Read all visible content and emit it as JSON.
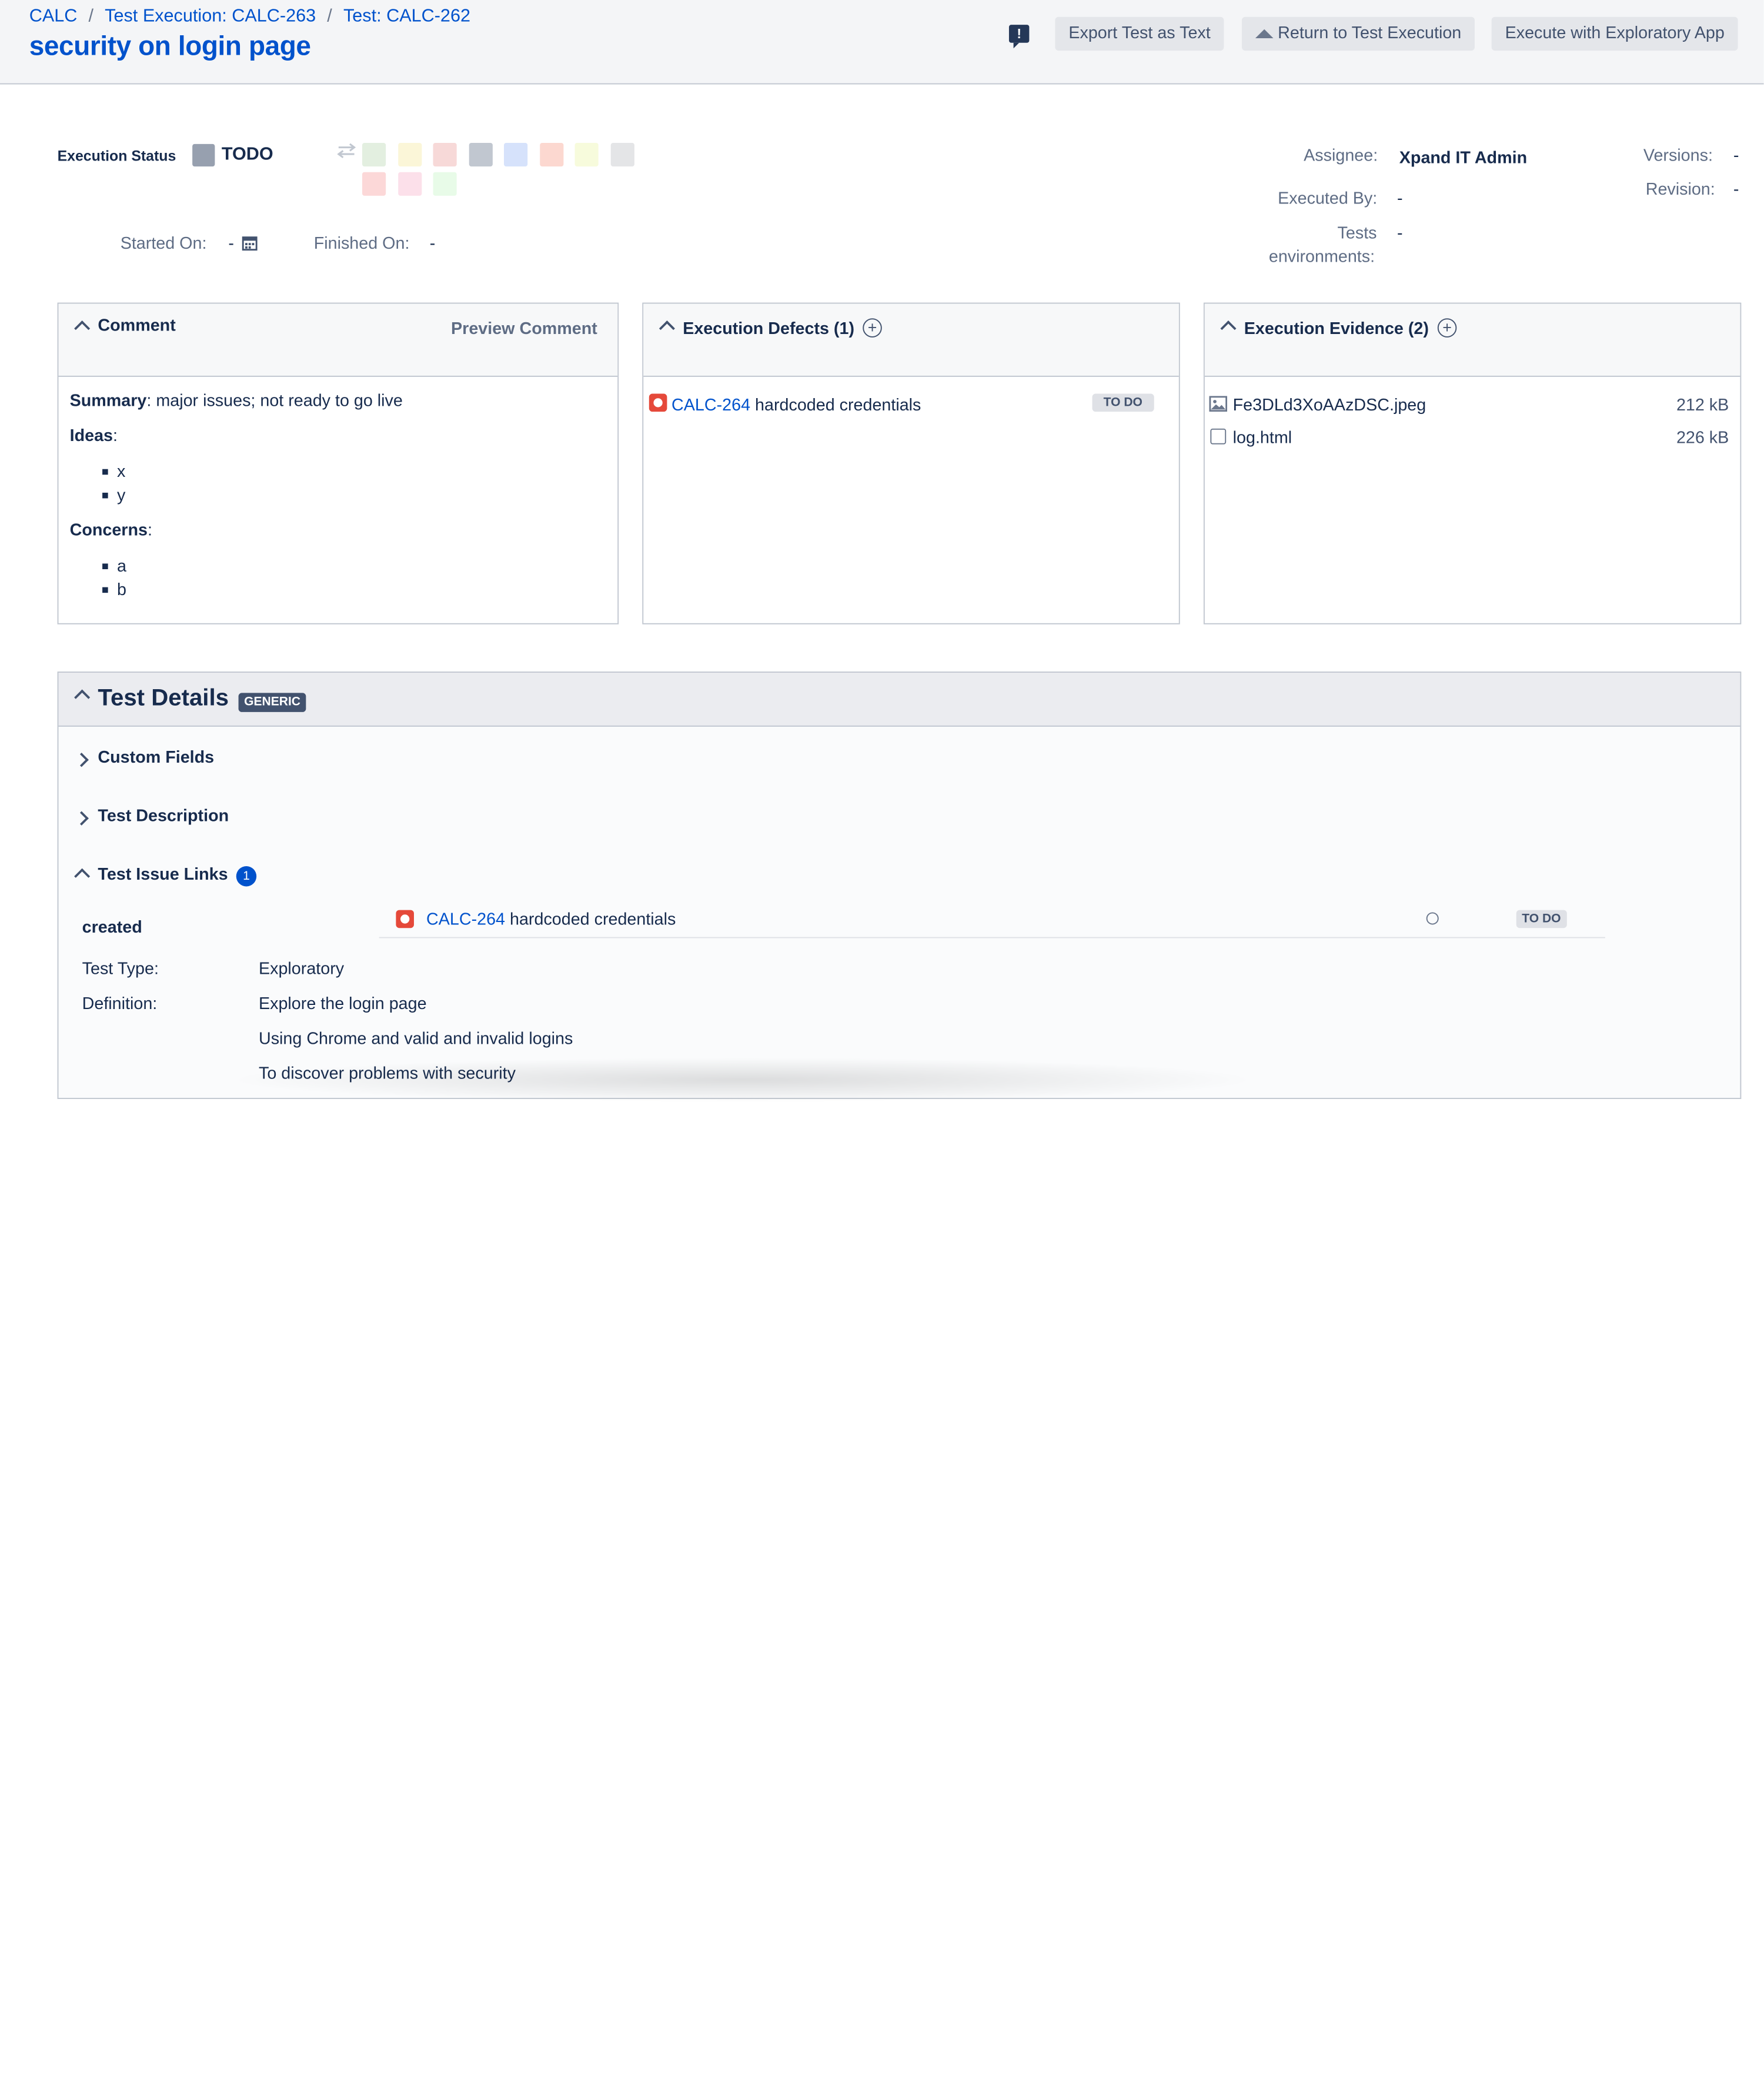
{
  "breadcrumbs": [
    "CALC",
    "Test Execution: CALC-263",
    "Test: CALC-262"
  ],
  "breadcrumb_sep": "/",
  "title": "security on login page",
  "feedback_glyph": "!",
  "toolbar": {
    "export_label": "Export Test as Text",
    "return_label": "Return to Test Execution",
    "exploratory_label": "Execute with Exploratory App"
  },
  "status": {
    "label": "Execution Status",
    "value": "TODO",
    "color": "#97a0af",
    "swatches": [
      "#e3efe0",
      "#fbf6d8",
      "#f7d9d8",
      "#c1c7d0",
      "#d6e2fb",
      "#fcd8d0",
      "#f7fbdc",
      "#e4e5e7",
      "#fcd8d8",
      "#fce0ea",
      "#e8fbe8"
    ]
  },
  "started_on": {
    "label": "Started On:",
    "value": "-"
  },
  "finished_on": {
    "label": "Finished On:",
    "value": "-"
  },
  "assignee": {
    "label": "Assignee:",
    "value": "Xpand IT Admin"
  },
  "executed_by": {
    "label": "Executed By:",
    "value": "-"
  },
  "tests_env": {
    "label_line1": "Tests",
    "label_line2": "environments:",
    "value": "-"
  },
  "versions": {
    "label": "Versions:",
    "value": "-"
  },
  "revision": {
    "label": "Revision:",
    "value": "-"
  },
  "comment": {
    "title": "Comment",
    "preview": "Preview Comment",
    "summary_label": "Summary",
    "summary_text": ": major issues; not ready to go live",
    "ideas_label": "Ideas",
    "ideas": [
      "x",
      "y"
    ],
    "concerns_label": "Concerns",
    "concerns": [
      "a",
      "b"
    ],
    "colon": ":"
  },
  "defects": {
    "title": "Execution Defects (1)",
    "items": [
      {
        "key": "CALC-264",
        "summary": "hardcoded credentials",
        "status": "TO DO"
      }
    ]
  },
  "evidence": {
    "title": "Execution Evidence (2)",
    "files": [
      {
        "name": "Fe3DLd3XoAAzDSC.jpeg",
        "size": "212 kB"
      },
      {
        "name": "log.html",
        "size": "226 kB"
      }
    ]
  },
  "details": {
    "title": "Test Details",
    "badge": "GENERIC",
    "custom_fields": "Custom Fields",
    "test_description": "Test Description",
    "issue_links": "Test Issue Links",
    "issue_links_count": "1",
    "link_type": "created",
    "link": {
      "key": "CALC-264",
      "summary": "hardcoded credentials",
      "status": "TO DO"
    },
    "test_type_label": "Test Type:",
    "test_type": "Exploratory",
    "definition_label": "Definition:",
    "definition_lines": [
      "Explore the login page",
      "Using Chrome and valid and invalid logins",
      "To discover problems with security"
    ]
  }
}
